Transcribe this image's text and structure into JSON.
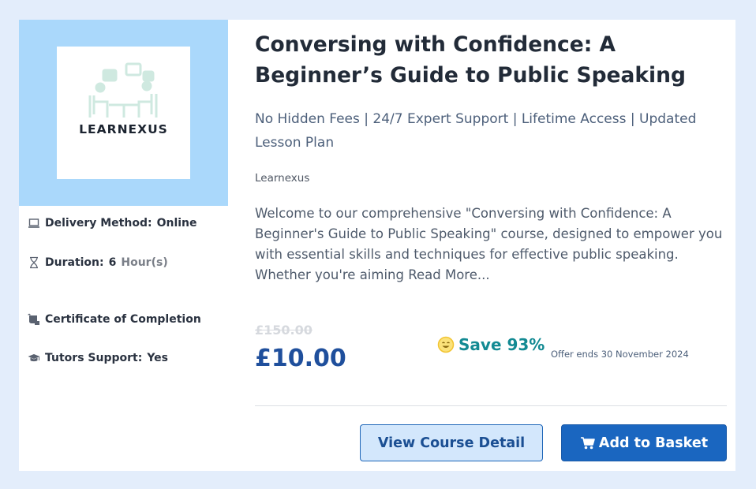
{
  "logo": {
    "text": "LEARNEXUS"
  },
  "features": {
    "delivery": {
      "label": "Delivery Method:",
      "value": "Online",
      "icon": "laptop-icon"
    },
    "duration": {
      "label": "Duration:",
      "value": "6",
      "unit": "Hour(s)",
      "icon": "hourglass-icon"
    },
    "certificate": {
      "label": "Certificate of Completion",
      "icon": "certificate-icon"
    },
    "tutors": {
      "label": "Tutors Support:",
      "value": "Yes",
      "icon": "graduation-cap-icon"
    }
  },
  "course": {
    "title": "Conversing with Confidence: A Beginner’s Guide to Public Speaking",
    "tagline": "No Hidden Fees | 24/7 Expert Support | Lifetime Access | Updated Lesson Plan",
    "provider": "Learnexus",
    "description": "Welcome to our comprehensive \"Conversing with Confidence: A Beginner's Guide to Public Speaking\" course, designed to empower you with essential skills and techniques for effective public speaking. Whether you're aiming",
    "read_more": "Read More..."
  },
  "pricing": {
    "old_price": "£150.00",
    "price": "£10.00",
    "save": "Save 93%",
    "offer": "Offer ends 30 November 2024"
  },
  "buttons": {
    "view_detail": "View Course Detail",
    "add_to_basket": "Add to Basket"
  },
  "colors": {
    "thumb_bg": "#aad8fb",
    "price": "#1f4f9c",
    "save": "#138a93",
    "primary_button": "#1a66c0",
    "secondary_button": "#d3e7fc"
  }
}
